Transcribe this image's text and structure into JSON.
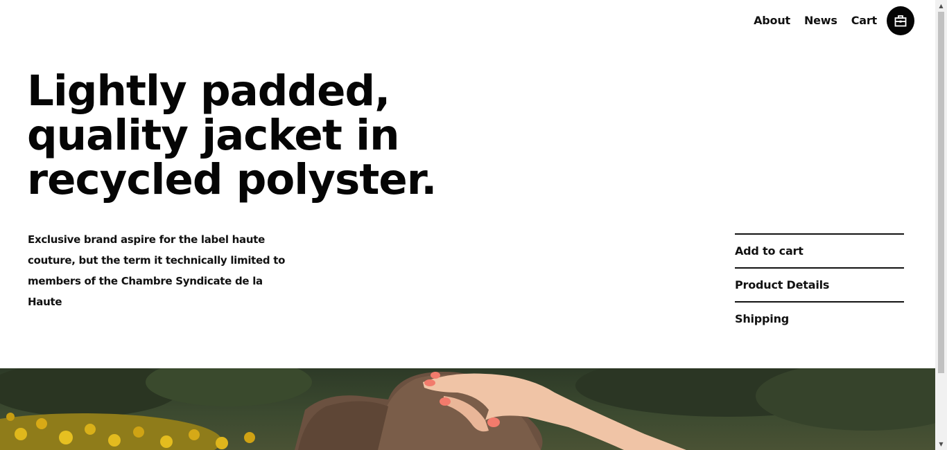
{
  "nav": {
    "items": [
      {
        "label": "About"
      },
      {
        "label": "News"
      },
      {
        "label": "Cart"
      }
    ],
    "bag_icon": "shopping-bag-icon"
  },
  "hero": {
    "headline": "Lightly padded, quality jacket in recycled polyster.",
    "description": "Exclusive brand aspire for the label haute couture, but the term it technically limited to members of the Chambre Syndicate de la Haute"
  },
  "side_menu": {
    "items": [
      {
        "label": "Add to cart"
      },
      {
        "label": "Product Details"
      },
      {
        "label": "Shipping"
      }
    ]
  },
  "photo": {
    "subject": "hand-on-felt-hat-image"
  },
  "colors": {
    "text": "#111111",
    "button_bg": "#050505",
    "background": "#ffffff"
  }
}
